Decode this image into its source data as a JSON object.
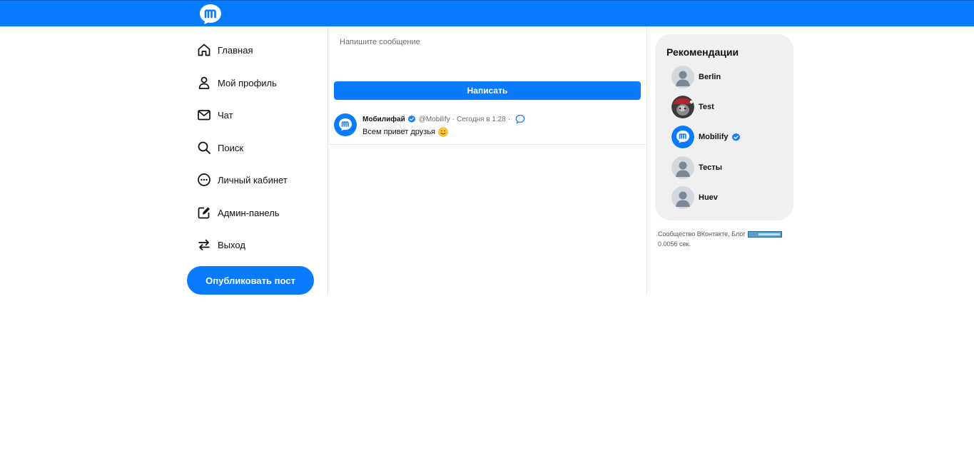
{
  "header": {
    "logo_icon": "mobilify-logo-icon",
    "brand_color": "#0a7aff"
  },
  "sidebar": {
    "items": [
      {
        "label": "Главная",
        "icon": "home-icon"
      },
      {
        "label": "Мой профиль",
        "icon": "user-icon"
      },
      {
        "label": "Чат",
        "icon": "mail-icon"
      },
      {
        "label": "Поиск",
        "icon": "search-icon"
      },
      {
        "label": "Личный кабинет",
        "icon": "more-circle-icon"
      },
      {
        "label": "Админ-панель",
        "icon": "edit-icon"
      },
      {
        "label": "Выход",
        "icon": "swap-arrows-icon"
      }
    ],
    "publish_label": "Опубликовать пост"
  },
  "composer": {
    "placeholder": "Напишите сообщение",
    "submit_label": "Написать"
  },
  "feed": {
    "posts": [
      {
        "author": "Мобилифай",
        "verified": true,
        "handle": "@Mobilify",
        "dot": "·",
        "time": "Сегодня в 1:28",
        "text": "Всем привет друзья",
        "emoji": "smile-emoji"
      }
    ]
  },
  "recommendations": {
    "title": "Рекомендации",
    "users": [
      {
        "name": "Berlin",
        "avatar": "default-avatar",
        "verified": false
      },
      {
        "name": "Test",
        "avatar": "photo-avatar",
        "verified": false
      },
      {
        "name": "Mobilify",
        "avatar": "mobilify-avatar",
        "verified": true
      },
      {
        "name": "Тесты",
        "avatar": "default-avatar",
        "verified": false
      },
      {
        "name": "Huev",
        "avatar": "default-avatar",
        "verified": false
      }
    ]
  },
  "footer": {
    "vk_link": "Сообщество ВКонтакте",
    "comma": ",",
    "blog_link": "Блог",
    "load_time": "0.0056 сек."
  }
}
